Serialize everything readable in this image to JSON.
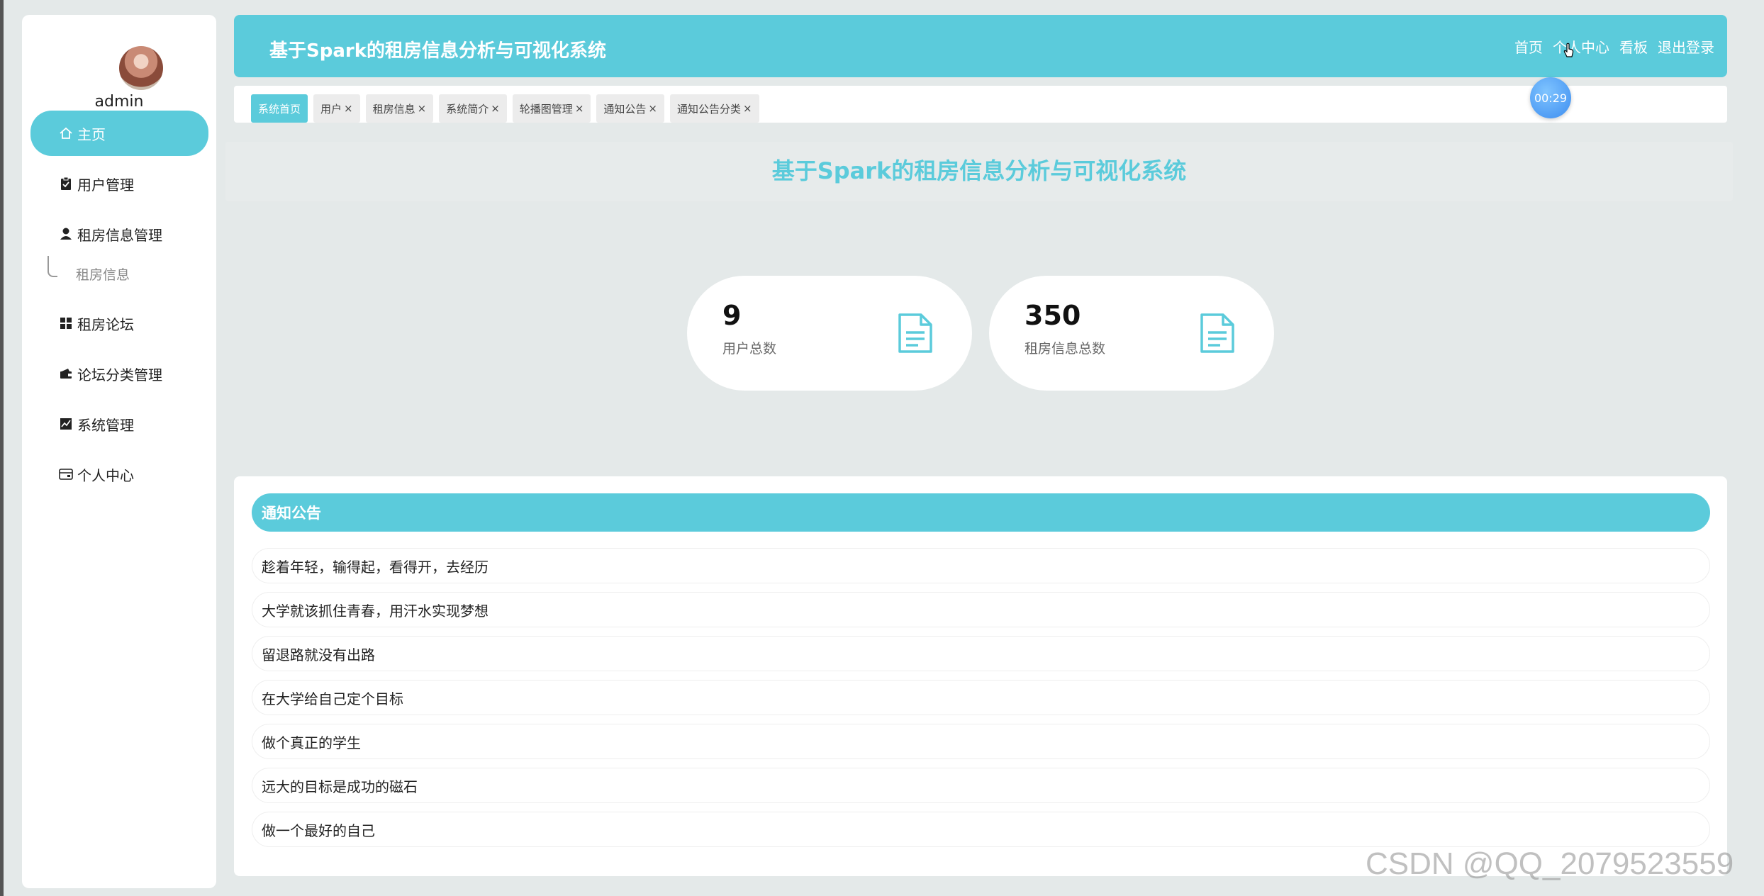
{
  "user": {
    "name": "admin"
  },
  "sidebar": {
    "items": [
      {
        "label": "主页",
        "icon": "home-icon"
      },
      {
        "label": "用户管理",
        "icon": "clipboard-icon"
      },
      {
        "label": "租房信息管理",
        "icon": "person-icon"
      },
      {
        "label": "租房论坛",
        "icon": "grid-icon"
      },
      {
        "label": "论坛分类管理",
        "icon": "wallet-icon"
      },
      {
        "label": "系统管理",
        "icon": "chart-icon"
      },
      {
        "label": "个人中心",
        "icon": "card-icon"
      }
    ],
    "submenu": {
      "label": "租房信息"
    }
  },
  "header": {
    "title": "基于Spark的租房信息分析与可视化系统",
    "nav": [
      "首页",
      "个人中心",
      "看板",
      "退出登录"
    ]
  },
  "tabs": [
    {
      "label": "系统首页"
    },
    {
      "label": "用户",
      "close": "×"
    },
    {
      "label": "租房信息",
      "close": "×"
    },
    {
      "label": "系统简介",
      "close": "×"
    },
    {
      "label": "轮播图管理",
      "close": "×"
    },
    {
      "label": "通知公告",
      "close": "×"
    },
    {
      "label": "通知公告分类",
      "close": "×"
    }
  ],
  "timer": "00:29",
  "main": {
    "title": "基于Spark的租房信息分析与可视化系统",
    "stats": [
      {
        "value": "9",
        "label": "用户总数",
        "icon": "document-icon"
      },
      {
        "value": "350",
        "label": "租房信息总数",
        "icon": "document-icon"
      }
    ],
    "notice": {
      "title": "通知公告",
      "items": [
        "趁着年轻，输得起，看得开，去经历",
        "大学就该抓住青春，用汗水实现梦想",
        "留退路就没有出路",
        "在大学给自己定个目标",
        "做个真正的学生",
        "远大的目标是成功的磁石",
        "做一个最好的自己"
      ]
    }
  },
  "watermark": "CSDN @QQ_2079523559",
  "colors": {
    "accent": "#5bcbdb",
    "background": "#e4e9e9",
    "timer": "#3d8df0"
  }
}
